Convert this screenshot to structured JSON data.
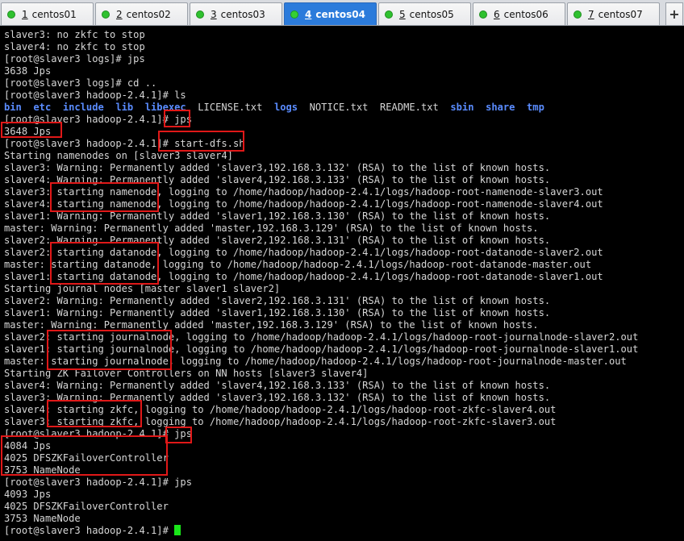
{
  "tabs": [
    {
      "num": "1",
      "name": "centos01",
      "active": false
    },
    {
      "num": "2",
      "name": "centos02",
      "active": false
    },
    {
      "num": "3",
      "name": "centos03",
      "active": false
    },
    {
      "num": "4",
      "name": "centos04",
      "active": true
    },
    {
      "num": "5",
      "name": "centos05",
      "active": false
    },
    {
      "num": "6",
      "name": "centos06",
      "active": false
    },
    {
      "num": "7",
      "name": "centos07",
      "active": false
    }
  ],
  "add_tab_label": "+",
  "colors": {
    "background": "#000000",
    "text": "#d6d6d6",
    "directory": "#5a8cff",
    "cursor": "#19e619",
    "highlight_box": "#e01818",
    "active_tab": "#2b7bdb",
    "status_dot": "#2fc12f"
  },
  "terminal": {
    "lines": [
      "slaver3: no zkfc to stop",
      "slaver4: no zkfc to stop",
      "[root@slaver3 logs]# jps",
      "3638 Jps",
      "[root@slaver3 logs]# cd ..",
      "[root@slaver3 hadoop-2.4.1]# ls",
      "",
      "[root@slaver3 hadoop-2.4.1]# jps",
      "3648 Jps",
      "[root@slaver3 hadoop-2.4.1]# start-dfs.sh",
      "Starting namenodes on [slaver3 slaver4]",
      "slaver3: Warning: Permanently added 'slaver3,192.168.3.132' (RSA) to the list of known hosts.",
      "slaver4: Warning: Permanently added 'slaver4,192.168.3.133' (RSA) to the list of known hosts.",
      "slaver3: starting namenode, logging to /home/hadoop/hadoop-2.4.1/logs/hadoop-root-namenode-slaver3.out",
      "slaver4: starting namenode, logging to /home/hadoop/hadoop-2.4.1/logs/hadoop-root-namenode-slaver4.out",
      "slaver1: Warning: Permanently added 'slaver1,192.168.3.130' (RSA) to the list of known hosts.",
      "master: Warning: Permanently added 'master,192.168.3.129' (RSA) to the list of known hosts.",
      "slaver2: Warning: Permanently added 'slaver2,192.168.3.131' (RSA) to the list of known hosts.",
      "slaver2: starting datanode, logging to /home/hadoop/hadoop-2.4.1/logs/hadoop-root-datanode-slaver2.out",
      "master: starting datanode, logging to /home/hadoop/hadoop-2.4.1/logs/hadoop-root-datanode-master.out",
      "slaver1: starting datanode, logging to /home/hadoop/hadoop-2.4.1/logs/hadoop-root-datanode-slaver1.out",
      "Starting journal nodes [master slaver1 slaver2]",
      "slaver2: Warning: Permanently added 'slaver2,192.168.3.131' (RSA) to the list of known hosts.",
      "slaver1: Warning: Permanently added 'slaver1,192.168.3.130' (RSA) to the list of known hosts.",
      "master: Warning: Permanently added 'master,192.168.3.129' (RSA) to the list of known hosts.",
      "slaver2: starting journalnode, logging to /home/hadoop/hadoop-2.4.1/logs/hadoop-root-journalnode-slaver2.out",
      "slaver1: starting journalnode, logging to /home/hadoop/hadoop-2.4.1/logs/hadoop-root-journalnode-slaver1.out",
      "master: starting journalnode, logging to /home/hadoop/hadoop-2.4.1/logs/hadoop-root-journalnode-master.out",
      "Starting ZK Failover Controllers on NN hosts [slaver3 slaver4]",
      "slaver4: Warning: Permanently added 'slaver4,192.168.3.133' (RSA) to the list of known hosts.",
      "slaver3: Warning: Permanently added 'slaver3,192.168.3.132' (RSA) to the list of known hosts.",
      "slaver4: starting zkfc, logging to /home/hadoop/hadoop-2.4.1/logs/hadoop-root-zkfc-slaver4.out",
      "slaver3: starting zkfc, logging to /home/hadoop/hadoop-2.4.1/logs/hadoop-root-zkfc-slaver3.out",
      "[root@slaver3 hadoop-2.4.1]# jps",
      "4084 Jps",
      "4025 DFSZKFailoverController",
      "3753 NameNode",
      "[root@slaver3 hadoop-2.4.1]# jps",
      "4093 Jps",
      "4025 DFSZKFailoverController",
      "3753 NameNode",
      "[root@slaver3 hadoop-2.4.1]# "
    ],
    "ls_output": [
      {
        "name": "bin",
        "type": "dir"
      },
      {
        "name": "etc",
        "type": "dir"
      },
      {
        "name": "include",
        "type": "dir"
      },
      {
        "name": "lib",
        "type": "dir"
      },
      {
        "name": "libexec",
        "type": "dir"
      },
      {
        "name": "LICENSE.txt",
        "type": "file"
      },
      {
        "name": "logs",
        "type": "dir"
      },
      {
        "name": "NOTICE.txt",
        "type": "file"
      },
      {
        "name": "README.txt",
        "type": "file"
      },
      {
        "name": "sbin",
        "type": "dir"
      },
      {
        "name": "share",
        "type": "dir"
      },
      {
        "name": "tmp",
        "type": "dir"
      }
    ]
  }
}
